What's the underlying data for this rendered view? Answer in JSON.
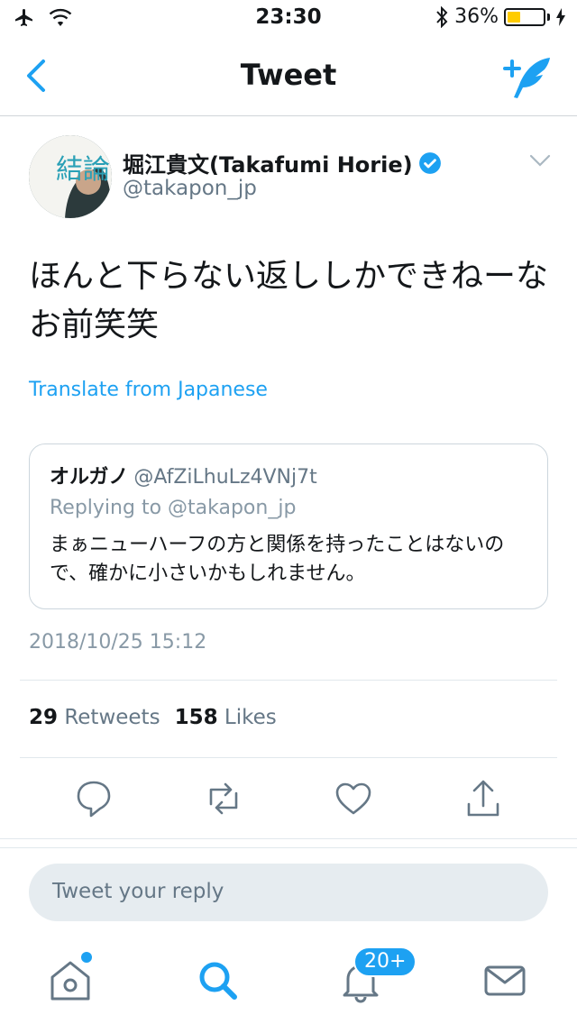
{
  "status_bar": {
    "time": "23:30",
    "battery": "36%",
    "battery_level": 0.36
  },
  "nav": {
    "title": "Tweet"
  },
  "tweet": {
    "author_name": "堀江貴文(Takafumi Horie)",
    "author_handle": "@takapon_jp",
    "text": "ほんと下らない返ししかできねーなお前笑笑",
    "translate_label": "Translate from Japanese",
    "timestamp": "2018/10/25 15:12",
    "retweets_count": "29",
    "retweets_label": "Retweets",
    "likes_count": "158",
    "likes_label": "Likes"
  },
  "quoted": {
    "name": "オルガノ",
    "handle": "@AfZiLhuLz4VNj7t",
    "replying": "Replying to @takapon_jp",
    "text": "まぁニューハーフの方と関係を持ったことはないので、確かに小さいかもしれません。"
  },
  "avatar_text": "結論",
  "reply_placeholder": "Tweet your reply",
  "tabbar": {
    "notifications_badge": "20+"
  },
  "colors": {
    "accent": "#1da1f2",
    "muted": "#657786",
    "battery": "#ffcc00"
  }
}
